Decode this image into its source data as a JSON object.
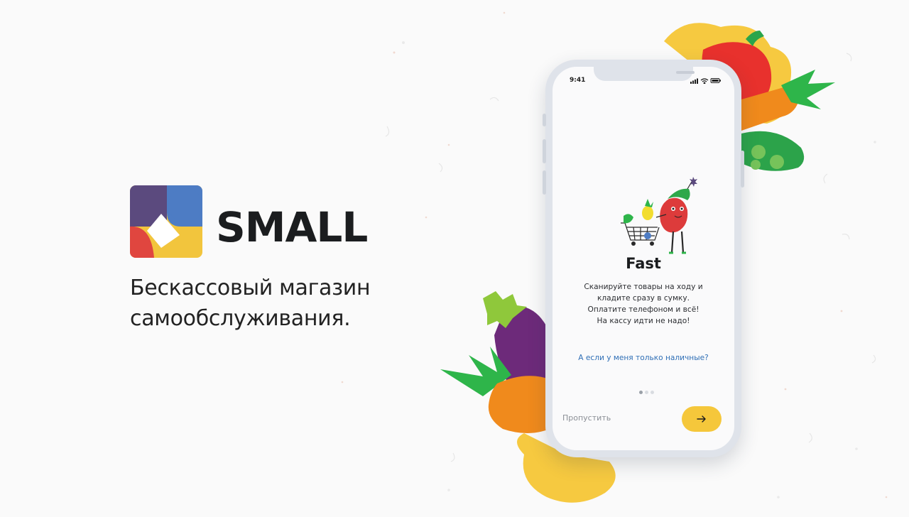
{
  "brand": {
    "name": "SMALL",
    "tagline": [
      "Бескассовый магазин",
      "самообслуживания."
    ]
  },
  "phone": {
    "status_time": "9:41",
    "screen": {
      "title": "Fast",
      "description": [
        "Сканируйте товары на ходу и",
        "кладите сразу в сумку.",
        "Оплатите телефоном и всё!",
        "На кассу идти не надо!"
      ],
      "cash_link": "А если у меня только наличные?",
      "pagination": {
        "current": 1,
        "total": 3
      },
      "skip_label": "Пропустить",
      "next_icon": "arrow-right-icon"
    }
  },
  "colors": {
    "accent_yellow": "#f5c73b",
    "link_blue": "#2f6fb6",
    "logo_purple": "#5b4a7e",
    "logo_red": "#e0463f",
    "logo_blue": "#4d7cc4",
    "logo_yellow": "#f2c53d"
  }
}
